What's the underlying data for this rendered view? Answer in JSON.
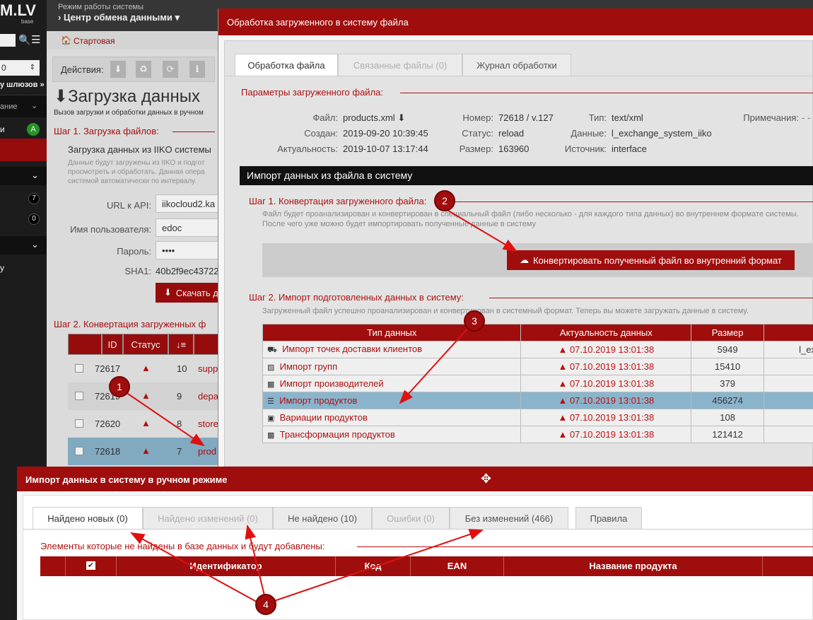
{
  "app": {
    "logo": "M.LV",
    "logo_sub": "base",
    "mode_label": "Режим работы системы",
    "mode_value": "Центр обмена данными"
  },
  "sidebar": {
    "gateways_link": "у шлюзов »",
    "item1": "ание",
    "item2": "и",
    "badge_a": "A",
    "badge_7": "7",
    "badge_0": "0",
    "item3": "y",
    "select_value": "0"
  },
  "breadcrumb": {
    "home": "Стартовая"
  },
  "main": {
    "actions_label": "Действия:",
    "page_title": "Загрузка данных",
    "page_subtitle": "Вызов загрузки и обработки данных в ручном",
    "step1": "Шаг 1. Загрузка файлов:",
    "load_title": "Загрузка данных из IIKO системы",
    "load_hint": "Данные будут загружены из IIKO и подгот просмотреть и обработать. Данная опера системой автоматически по интервалу.",
    "url_label": "URL к API:",
    "url_value": "iikocloud2.ka",
    "user_label": "Имя пользователя:",
    "user_value": "edoc",
    "pass_label": "Пароль:",
    "pass_value": "••••",
    "sha_label": "SHA1:",
    "sha_value": "40b2f9ec43722",
    "download_btn": "Скачать д",
    "step2": "Шаг 2. Конвертация загруженных ф",
    "table_headers": [
      "ID",
      "Статус",
      "↓≡"
    ],
    "rows": [
      {
        "id": "72617",
        "num": "10",
        "name": "supp"
      },
      {
        "id": "72619",
        "num": "9",
        "name": "depa"
      },
      {
        "id": "72620",
        "num": "8",
        "name": "store"
      },
      {
        "id": "72618",
        "num": "7",
        "name": "prod"
      }
    ]
  },
  "dialog1": {
    "title": "Обработка загруженного в систему файла",
    "tabs": [
      "Обработка файла",
      "Связанные файлы (0)",
      "Журнал обработки"
    ],
    "params_legend": "Параметры загруженного файла:",
    "file_label": "Файл:",
    "file_value": "products.xml",
    "created_label": "Создан:",
    "created_value": "2019-09-20 10:39:45",
    "actual_label": "Актуальность:",
    "actual_value": "2019-10-07 13:17:44",
    "number_label": "Номер:",
    "number_value": "72618 / v.127",
    "status_label": "Статус:",
    "status_value": "reload",
    "size_label": "Размер:",
    "size_value": "163960",
    "type_label": "Тип:",
    "type_value": "text/xml",
    "data_label": "Данные:",
    "data_value": "l_exchange_system_iiko",
    "source_label": "Источник:",
    "source_value": "interface",
    "notes_label": "Примечания:",
    "notes_value": "- - -",
    "import_header": "Импорт данных из файла в систему",
    "step1_legend": "Шаг 1. Конвертация загруженного файла:",
    "step1_hint": "Файл будет проанализирован и конвертирован в специальный файл (либо несколько - для каждого типа данных) во внутреннем формате системы. После чего уже можно будет импортировать полученные данные в систему",
    "convert_btn": "Конвертировать полученный файл во внутренний формат",
    "step2_legend": "Шаг 2. Импорт подготовленных данных в систему:",
    "step2_hint": "Загруженный файл успешно проанализирован и конвертирован в системный формат. Теперь вы можете загружать данные в систему.",
    "table_headers": [
      "Тип данных",
      "Актуальность данных",
      "Размер"
    ],
    "rows": [
      {
        "icon": "truck-icon",
        "name": "Импорт точек доставки клиентов",
        "date": "07.10.2019 13:01:38",
        "size": "5949",
        "extra": "l_ex"
      },
      {
        "icon": "sitemap-icon",
        "name": "Импорт групп",
        "date": "07.10.2019 13:01:38",
        "size": "15410",
        "extra": ""
      },
      {
        "icon": "industry-icon",
        "name": "Импорт производителей",
        "date": "07.10.2019 13:01:38",
        "size": "379",
        "extra": ""
      },
      {
        "icon": "list-icon",
        "name": "Импорт продуктов",
        "date": "07.10.2019 13:01:38",
        "size": "456274",
        "extra": ""
      },
      {
        "icon": "object-group-icon",
        "name": "Вариации продуктов",
        "date": "07.10.2019 13:01:38",
        "size": "108",
        "extra": ""
      },
      {
        "icon": "industry-icon",
        "name": "Трансформация продуктов",
        "date": "07.10.2019 13:01:38",
        "size": "121412",
        "extra": ""
      }
    ]
  },
  "dialog2": {
    "title": "Импорт данных в систему в ручном режиме",
    "tabs": [
      "Найдено новых (0)",
      "Найдено изменений (0)",
      "Не найдено (10)",
      "Ошибки (0)",
      "Без изменений (466)",
      "Правила"
    ],
    "legend": "Элементы которые не найдены в базе данных и будут добавлены:",
    "table_headers": [
      "✔",
      "Идентификатор",
      "Код",
      "EAN",
      "Название продукта"
    ]
  },
  "annotations": {
    "m1": "1",
    "m2": "2",
    "m3": "3",
    "m4": "4"
  },
  "colors": {
    "accent": "#a00d0d",
    "selected_row": "#8ab4cc",
    "sidebar": "#1e1e1e"
  }
}
